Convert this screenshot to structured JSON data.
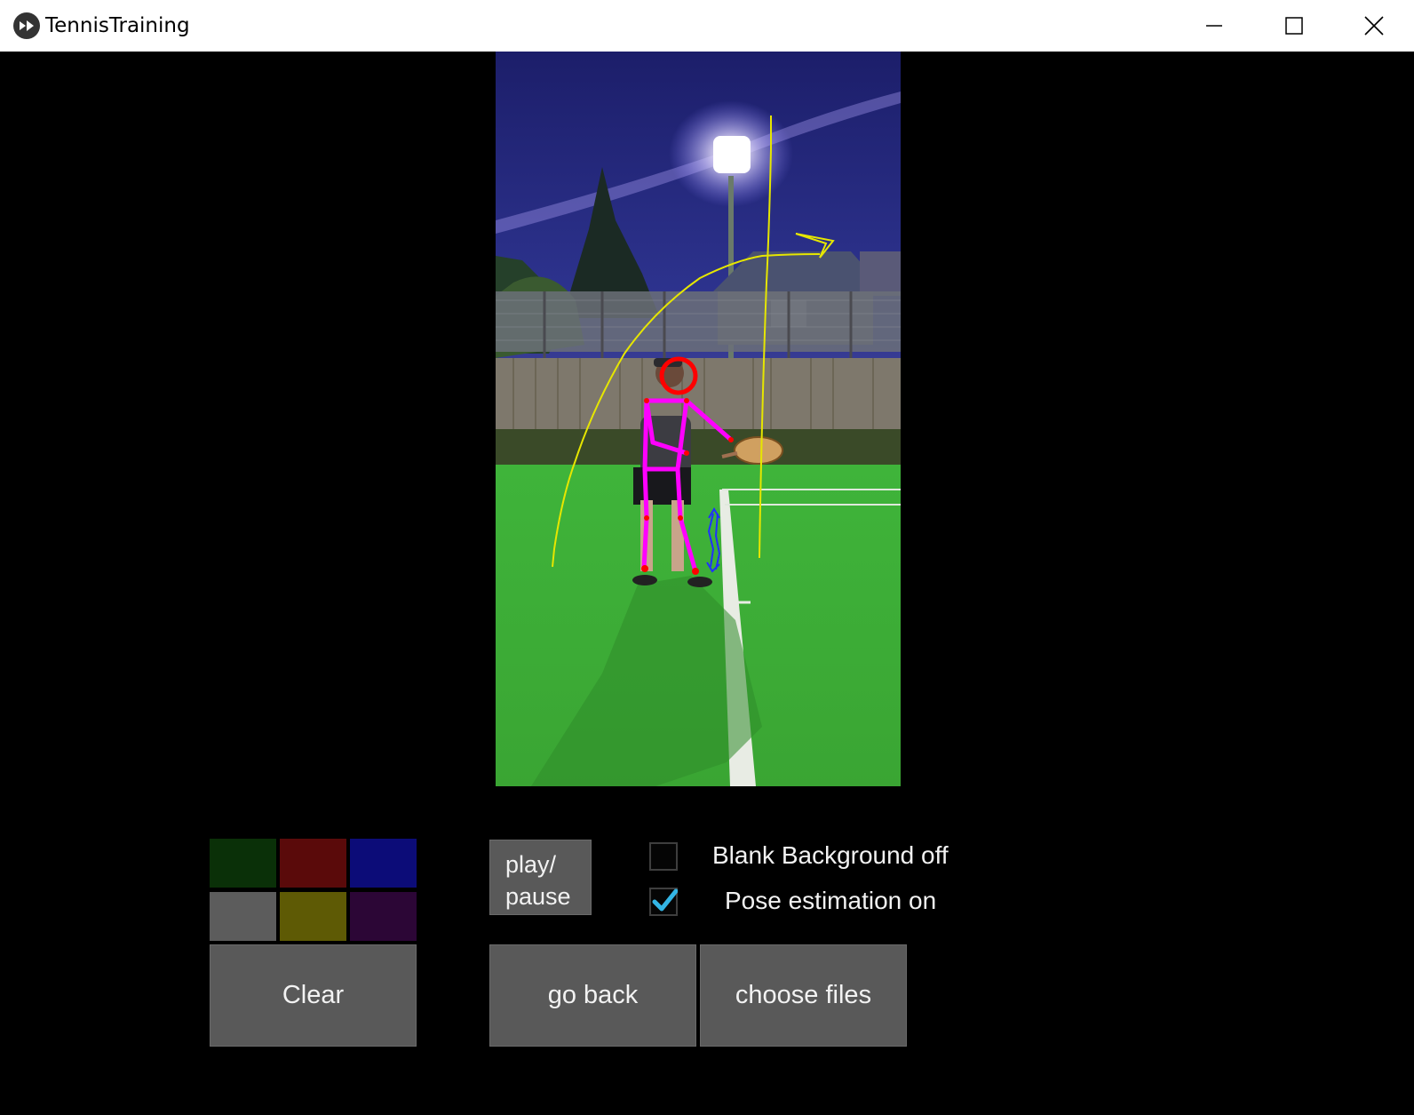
{
  "window": {
    "title": "TennisTraining"
  },
  "palette": {
    "colors": [
      "#0a3008",
      "#5a0a0a",
      "#0c0c78",
      "#5c5c5c",
      "#5e5a05",
      "#2c0636"
    ]
  },
  "controls": {
    "clear_label": "Clear",
    "play_pause_label": "play/\npause",
    "go_back_label": "go back",
    "choose_files_label": "choose files",
    "blank_background": {
      "label": "Blank Background off",
      "checked": false
    },
    "pose_estimation": {
      "label": "Pose estimation on",
      "checked": true
    }
  },
  "theme": {
    "accent": "#33b5e5",
    "pose_skeleton": "#ff00ff",
    "pose_joint": "#ff0000",
    "drawing_yellow": "#e6e600",
    "drawing_blue": "#2030ff"
  }
}
